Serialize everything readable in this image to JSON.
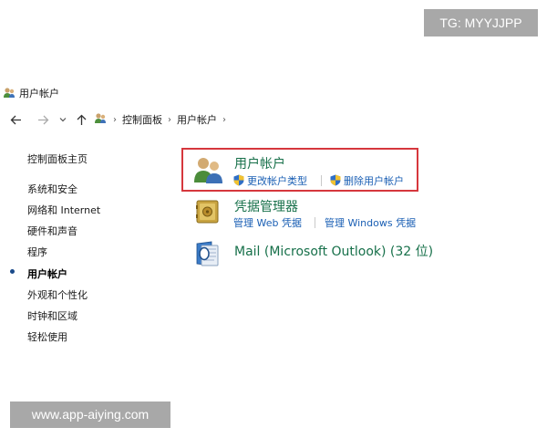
{
  "watermarks": {
    "tg": "TG: MYYJJPP",
    "site": "www.app-aiying.com"
  },
  "window": {
    "title": "用户帐户"
  },
  "nav": {
    "back_icon": "←",
    "forward_icon": "→",
    "dropdown_icon": "⌄",
    "up_icon": "↑",
    "breadcrumb": [
      "控制面板",
      "用户帐户"
    ],
    "chevron": "›"
  },
  "sidebar": {
    "home": "控制面板主页",
    "items": [
      {
        "label": "系统和安全"
      },
      {
        "label": "网络和 Internet"
      },
      {
        "label": "硬件和声音"
      },
      {
        "label": "程序"
      },
      {
        "label": "用户帐户",
        "active": true
      },
      {
        "label": "外观和个性化"
      },
      {
        "label": "时钟和区域"
      },
      {
        "label": "轻松使用"
      }
    ]
  },
  "main": {
    "groups": [
      {
        "title": "用户帐户",
        "icon": "users-icon",
        "links": [
          "更改帐户类型",
          "删除用户帐户"
        ]
      },
      {
        "title": "凭据管理器",
        "icon": "credential-vault-icon",
        "links": [
          "管理 Web 凭据",
          "管理 Windows 凭据"
        ]
      },
      {
        "title": "Mail (Microsoft Outlook) (32 位)",
        "icon": "mail-icon",
        "links": []
      }
    ]
  },
  "colors": {
    "group_title": "#17704a",
    "link": "#1a5fb4",
    "highlight": "#d6373d"
  }
}
